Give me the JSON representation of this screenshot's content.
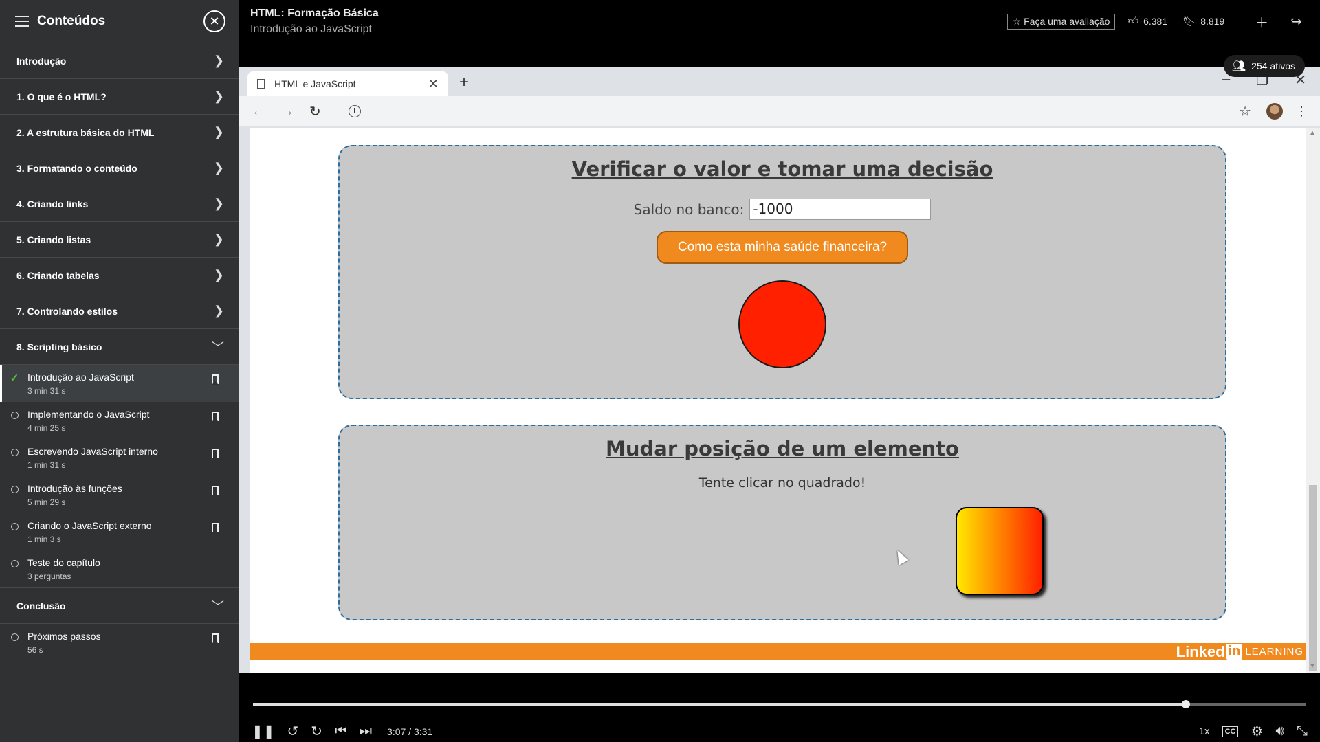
{
  "sidebar": {
    "title": "Conteúdos",
    "chapters": [
      {
        "label": "Introdução"
      },
      {
        "label": "1. O que é o HTML?"
      },
      {
        "label": "2. A estrutura básica do HTML"
      },
      {
        "label": "3. Formatando o conteúdo"
      },
      {
        "label": "4. Criando links"
      },
      {
        "label": "5. Criando listas"
      },
      {
        "label": "6. Criando tabelas"
      },
      {
        "label": "7. Controlando estilos"
      },
      {
        "label": "8. Scripting básico"
      }
    ],
    "chapter8_videos": [
      {
        "title": "Introdução ao JavaScript",
        "duration": "3 min 31 s"
      },
      {
        "title": "Implementando o JavaScript",
        "duration": "4 min 25 s"
      },
      {
        "title": "Escrevendo JavaScript interno",
        "duration": "1 min 31 s"
      },
      {
        "title": "Introdução às funções",
        "duration": "5 min 29 s"
      },
      {
        "title": "Criando o JavaScript externo",
        "duration": "1 min 3 s"
      },
      {
        "title": "Teste do capítulo",
        "duration": "3 perguntas"
      }
    ],
    "conclusion": {
      "label": "Conclusão"
    },
    "conclusion_videos": [
      {
        "title": "Próximos passos",
        "duration": "56 s"
      }
    ]
  },
  "topbar": {
    "course_title": "HTML: Formação Básica",
    "video_title": "Introdução ao JavaScript",
    "rate_label": "Faça uma avaliação",
    "likes": "6.381",
    "saves": "8.819"
  },
  "viewers": "254 ativos",
  "browser": {
    "tab_title": "HTML e JavaScript"
  },
  "demo": {
    "box1_title": "Verificar o valor e tomar uma decisão",
    "saldo_label": "Saldo no banco:",
    "saldo_value": "-1000",
    "button_label": "Como esta minha saúde financeira?",
    "status_color": "#ff2000",
    "box2_title": "Mudar posição de um elemento",
    "box2_hint": "Tente clicar no quadrado!"
  },
  "branding": {
    "linked": "Linked",
    "in": "in",
    "learning": "LEARNING"
  },
  "player": {
    "time": "3:07 / 3:31",
    "progress": 0.886,
    "speed": "1x",
    "cc": "CC"
  }
}
